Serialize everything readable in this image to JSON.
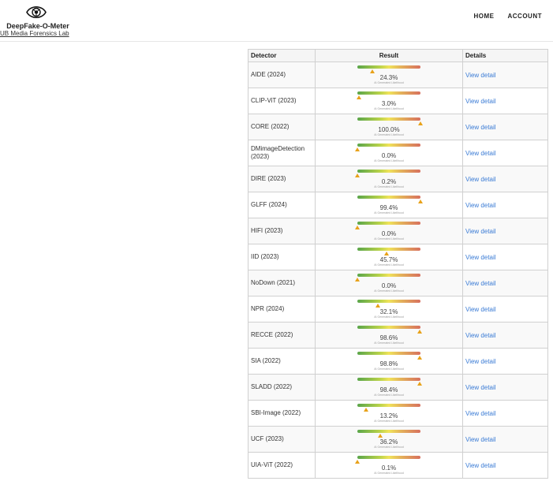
{
  "header": {
    "brand_title": "DeepFake-O-Meter",
    "brand_subtitle": "UB Media Forensics Lab",
    "logo_icon": "eye-icon",
    "nav": [
      {
        "label": "HOME"
      },
      {
        "label": "ACCOUNT"
      }
    ]
  },
  "table": {
    "columns": {
      "detector": "Detector",
      "result": "Result",
      "details": "Details"
    },
    "caption": "AI Generated Likelihood",
    "rows": [
      {
        "detector": "AIDE (2024)",
        "value": 24.3,
        "result": "24.3%",
        "detail": "View detail"
      },
      {
        "detector": "CLIP-ViT (2023)",
        "value": 3.0,
        "result": "3.0%",
        "detail": "View detail"
      },
      {
        "detector": "CORE (2022)",
        "value": 100.0,
        "result": "100.0%",
        "detail": "View detail"
      },
      {
        "detector": "DMimageDetection (2023)",
        "value": 0.0,
        "result": "0.0%",
        "detail": "View detail"
      },
      {
        "detector": "DIRE (2023)",
        "value": 0.2,
        "result": "0.2%",
        "detail": "View detail"
      },
      {
        "detector": "GLFF (2024)",
        "value": 99.4,
        "result": "99.4%",
        "detail": "View detail"
      },
      {
        "detector": "HIFI (2023)",
        "value": 0.0,
        "result": "0.0%",
        "detail": "View detail"
      },
      {
        "detector": "IID (2023)",
        "value": 45.7,
        "result": "45.7%",
        "detail": "View detail"
      },
      {
        "detector": "NoDown (2021)",
        "value": 0.0,
        "result": "0.0%",
        "detail": "View detail"
      },
      {
        "detector": "NPR (2024)",
        "value": 32.1,
        "result": "32.1%",
        "detail": "View detail"
      },
      {
        "detector": "RECCE (2022)",
        "value": 98.6,
        "result": "98.6%",
        "detail": "View detail"
      },
      {
        "detector": "SIA (2022)",
        "value": 98.8,
        "result": "98.8%",
        "detail": "View detail"
      },
      {
        "detector": "SLADD (2022)",
        "value": 98.4,
        "result": "98.4%",
        "detail": "View detail"
      },
      {
        "detector": "SBI-Image (2022)",
        "value": 13.2,
        "result": "13.2%",
        "detail": "View detail"
      },
      {
        "detector": "UCF (2023)",
        "value": 36.2,
        "result": "36.2%",
        "detail": "View detail"
      },
      {
        "detector": "UIA-ViT (2022)",
        "value": 0.1,
        "result": "0.1%",
        "detail": "View detail"
      }
    ]
  }
}
